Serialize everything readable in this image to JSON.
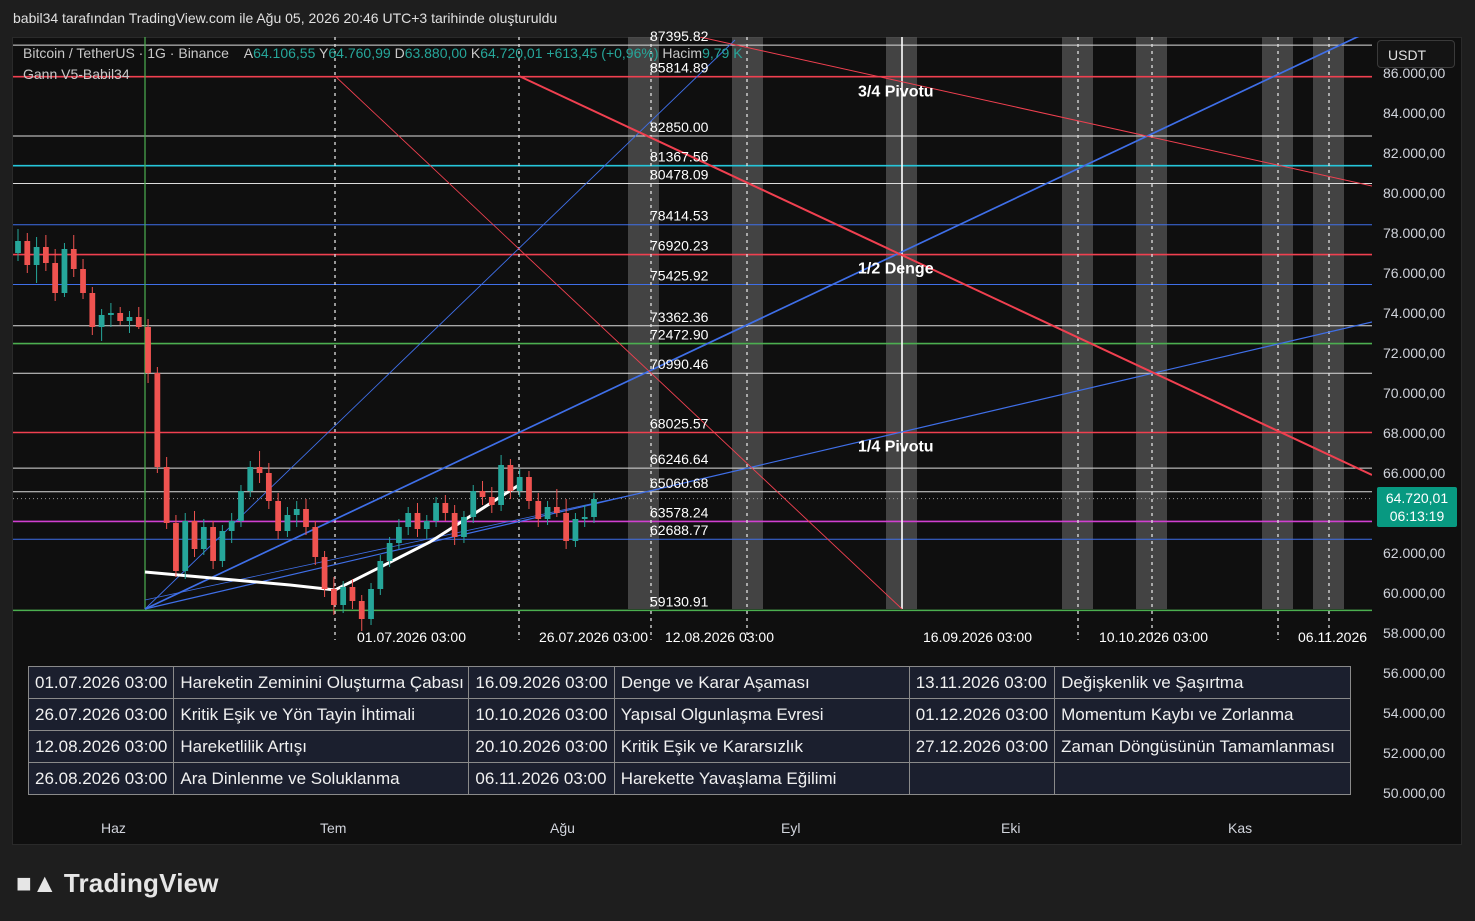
{
  "caption": "babil34 tarafından TradingView.com ile Ağu 05, 2026 20:46 UTC+3 tarihinde oluşturuldu",
  "legend": {
    "symbol": "Bitcoin / TetherUS · 1G · Binance",
    "o_label": "A",
    "o_value": "64.106,55",
    "h_label": "Y",
    "h_value": "64.760,99",
    "l_label": "D",
    "l_value": "63.880,00",
    "c_label": "K",
    "c_value": "64.720,01",
    "change": "+613,45 (+0,96%)",
    "vol_label": "Hacim",
    "vol_value": "9,79 K",
    "indicator": "Gann V5-Babil34"
  },
  "currency_button": "USDT",
  "price_badge": {
    "price": "64.720,01",
    "countdown": "06:13:19"
  },
  "colors": {
    "background": "#0f0f0f",
    "up": "#26a69a",
    "down": "#ef5350",
    "red_line": "#f04050",
    "blue_line": "#3f6fe8",
    "cyan_line": "#26c6da",
    "green_line": "#4caf50",
    "magenta_line": "#d040d0"
  },
  "chart_data": {
    "type": "candlestick",
    "ylim": [
      49000,
      87500
    ],
    "price_axis_labels": [
      "86.000,00",
      "84.000,00",
      "82.000,00",
      "80.000,00",
      "78.000,00",
      "76.000,00",
      "74.000,00",
      "72.000,00",
      "70.000,00",
      "68.000,00",
      "66.000,00",
      "64.000,00",
      "62.000,00",
      "60.000,00",
      "58.000,00",
      "56.000,00",
      "54.000,00",
      "52.000,00",
      "50.000,00"
    ],
    "price_axis_values": [
      86000,
      84000,
      82000,
      80000,
      78000,
      76000,
      74000,
      72000,
      70000,
      68000,
      66000,
      64000,
      62000,
      60000,
      58000,
      56000,
      54000,
      52000,
      50000
    ],
    "time_axis_labels": [
      "Haz",
      "Tem",
      "Ağu",
      "Eyl",
      "Eki",
      "Kas"
    ],
    "gann_levels": [
      {
        "value": 87395.82,
        "label": "87395.82",
        "color": "white"
      },
      {
        "value": 85814.89,
        "label": "85814.89",
        "color": "red"
      },
      {
        "value": 82850.0,
        "label": "82850.00",
        "color": "white"
      },
      {
        "value": 81367.56,
        "label": "81367.56",
        "color": "cyan"
      },
      {
        "value": 80478.09,
        "label": "80478.09",
        "color": "white"
      },
      {
        "value": 78414.53,
        "label": "78414.53",
        "color": "blue"
      },
      {
        "value": 76920.23,
        "label": "76920.23",
        "color": "red"
      },
      {
        "value": 75425.92,
        "label": "75425.92",
        "color": "blue"
      },
      {
        "value": 73362.36,
        "label": "73362.36",
        "color": "white"
      },
      {
        "value": 72472.9,
        "label": "72472.90",
        "color": "green"
      },
      {
        "value": 70990.46,
        "label": "70990.46",
        "color": "white"
      },
      {
        "value": 68025.57,
        "label": "68025.57",
        "color": "red"
      },
      {
        "value": 66246.64,
        "label": "66246.64",
        "color": "white"
      },
      {
        "value": 65060.68,
        "label": "65060.68",
        "color": "white"
      },
      {
        "value": 63578.24,
        "label": "63578.24",
        "color": "magenta"
      },
      {
        "value": 62688.77,
        "label": "62688.77",
        "color": "blue"
      },
      {
        "value": 59130.91,
        "label": "59130.91",
        "color": "green"
      }
    ],
    "annotations": [
      "3/4 Pivotu",
      "1/2 Denge",
      "1/4 Pivotu"
    ],
    "cycle_date_labels": [
      "01.07.2026 03:00",
      "26.07.2026 03:00",
      "12.08.2026 03:00",
      "16.09.2026 03:00",
      "10.10.2026 03:00",
      "06.11.2026"
    ],
    "candles": [
      [
        77000,
        78200,
        76600,
        77600
      ],
      [
        77600,
        78000,
        76000,
        76400
      ],
      [
        76400,
        77800,
        75500,
        77300
      ],
      [
        77300,
        77900,
        76100,
        76500
      ],
      [
        76500,
        77200,
        74600,
        75000
      ],
      [
        75000,
        77500,
        74800,
        77200
      ],
      [
        77200,
        77900,
        75800,
        76200
      ],
      [
        76200,
        76700,
        74700,
        75000
      ],
      [
        75000,
        75300,
        72900,
        73300
      ],
      [
        73300,
        74200,
        72600,
        73900
      ],
      [
        73900,
        74500,
        73300,
        74000
      ],
      [
        74000,
        74300,
        73400,
        73600
      ],
      [
        73600,
        74100,
        73000,
        73800
      ],
      [
        73800,
        74300,
        73200,
        73300
      ],
      [
        73300,
        73700,
        70500,
        71000
      ],
      [
        71000,
        71300,
        66000,
        66300
      ],
      [
        66300,
        66800,
        63200,
        63500
      ],
      [
        63500,
        63900,
        60800,
        61100
      ],
      [
        61100,
        64000,
        60700,
        63600
      ],
      [
        63600,
        64100,
        61800,
        62200
      ],
      [
        62200,
        63700,
        61900,
        63300
      ],
      [
        63300,
        63600,
        61200,
        61600
      ],
      [
        61600,
        63400,
        61300,
        63100
      ],
      [
        63100,
        64000,
        62500,
        63600
      ],
      [
        63600,
        65400,
        63300,
        65100
      ],
      [
        65100,
        66600,
        64800,
        66300
      ],
      [
        66300,
        67100,
        65500,
        66000
      ],
      [
        66000,
        66500,
        64200,
        64600
      ],
      [
        64600,
        65000,
        62700,
        63100
      ],
      [
        63100,
        64300,
        62800,
        63900
      ],
      [
        63900,
        64600,
        63300,
        64200
      ],
      [
        64200,
        64700,
        62900,
        63300
      ],
      [
        63300,
        63600,
        61400,
        61800
      ],
      [
        61800,
        62100,
        59800,
        60200
      ],
      [
        60200,
        60800,
        58900,
        59400
      ],
      [
        59400,
        60600,
        59000,
        60300
      ],
      [
        60300,
        60700,
        59200,
        59600
      ],
      [
        59600,
        59900,
        58100,
        58700
      ],
      [
        58700,
        60500,
        58400,
        60200
      ],
      [
        60200,
        61900,
        59900,
        61600
      ],
      [
        61600,
        62800,
        61300,
        62500
      ],
      [
        62500,
        63700,
        62200,
        63300
      ],
      [
        63300,
        64300,
        62900,
        64000
      ],
      [
        64000,
        64500,
        62800,
        63200
      ],
      [
        63200,
        63900,
        62700,
        63600
      ],
      [
        63600,
        64800,
        63300,
        64500
      ],
      [
        64500,
        64900,
        63600,
        64000
      ],
      [
        64000,
        64400,
        62400,
        62800
      ],
      [
        62800,
        64100,
        62500,
        63800
      ],
      [
        63800,
        65400,
        63500,
        65100
      ],
      [
        65100,
        65600,
        64400,
        64800
      ],
      [
        64800,
        65300,
        64000,
        64400
      ],
      [
        64400,
        66900,
        64100,
        66400
      ],
      [
        66400,
        66700,
        64700,
        65100
      ],
      [
        65100,
        66200,
        64800,
        65800
      ],
      [
        65800,
        66100,
        64200,
        64600
      ],
      [
        64600,
        65000,
        63300,
        63700
      ],
      [
        63700,
        64600,
        63400,
        64300
      ],
      [
        64300,
        65200,
        63800,
        64000
      ],
      [
        64000,
        64700,
        62200,
        62600
      ],
      [
        62600,
        64000,
        62300,
        63700
      ],
      [
        63700,
        64400,
        63300,
        63800
      ],
      [
        63800,
        65000,
        63500,
        64700
      ]
    ]
  },
  "events_table": [
    [
      {
        "date": "01.07.2026 03:00",
        "label": "Hareketin Zeminini Oluşturma Çabası"
      },
      {
        "date": "16.09.2026 03:00",
        "label": "Denge ve Karar Aşaması"
      },
      {
        "date": "13.11.2026 03:00",
        "label": "Değişkenlik ve Şaşırtma"
      }
    ],
    [
      {
        "date": "26.07.2026 03:00",
        "label": "Kritik Eşik ve Yön Tayin İhtimali"
      },
      {
        "date": "10.10.2026 03:00",
        "label": "Yapısal Olgunlaşma Evresi"
      },
      {
        "date": "01.12.2026 03:00",
        "label": "Momentum Kaybı ve Zorlanma"
      }
    ],
    [
      {
        "date": "12.08.2026 03:00",
        "label": "Hareketlilik Artışı"
      },
      {
        "date": "20.10.2026 03:00",
        "label": "Kritik Eşik ve Kararsızlık"
      },
      {
        "date": "27.12.2026 03:00",
        "label": "Zaman Döngüsünün Tamamlanması"
      }
    ],
    [
      {
        "date": "26.08.2026 03:00",
        "label": "Ara Dinlenme ve Soluklanma"
      },
      {
        "date": "06.11.2026 03:00",
        "label": "Harekette Yavaşlama Eğilimi"
      },
      {
        "date": "",
        "label": ""
      }
    ]
  ],
  "branding": "TradingView"
}
